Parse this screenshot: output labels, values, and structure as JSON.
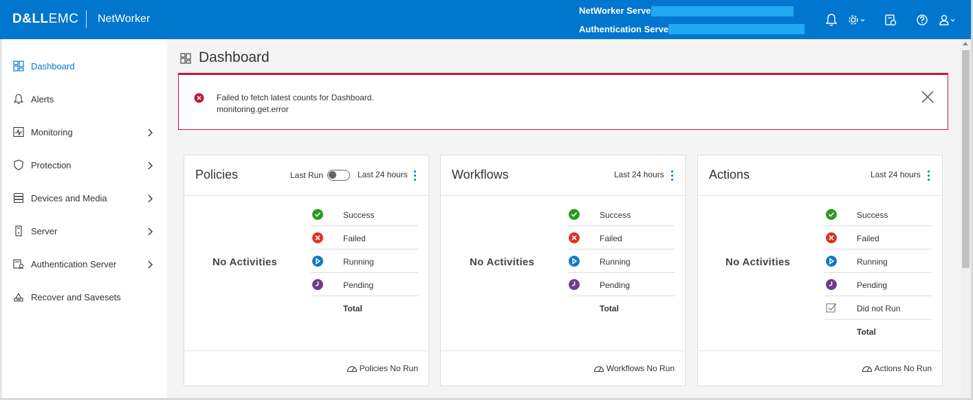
{
  "header": {
    "brand_bold": "D&LL",
    "brand_light": "EMC",
    "product": "NetWorker",
    "networker_server_label": "NetWorker Server:",
    "auth_server_label": "Authentication Server:",
    "icons": [
      "bell-icon",
      "gear-icon",
      "system-settings-icon",
      "help-icon",
      "user-icon"
    ]
  },
  "sidebar": {
    "items": [
      {
        "label": "Dashboard",
        "icon": "dashboard-icon",
        "active": true,
        "has_children": false
      },
      {
        "label": "Alerts",
        "icon": "bell-icon",
        "active": false,
        "has_children": false
      },
      {
        "label": "Monitoring",
        "icon": "monitoring-icon",
        "active": false,
        "has_children": true
      },
      {
        "label": "Protection",
        "icon": "shield-icon",
        "active": false,
        "has_children": true
      },
      {
        "label": "Devices and Media",
        "icon": "storage-icon",
        "active": false,
        "has_children": true
      },
      {
        "label": "Server",
        "icon": "server-icon",
        "active": false,
        "has_children": true
      },
      {
        "label": "Authentication Server",
        "icon": "auth-server-icon",
        "active": false,
        "has_children": true
      },
      {
        "label": "Recover and Savesets",
        "icon": "recover-icon",
        "active": false,
        "has_children": false
      }
    ]
  },
  "main": {
    "title": "Dashboard",
    "alert": {
      "line1": "Failed to fetch latest counts for Dashboard.",
      "line2": "monitoring.get.error"
    },
    "cards": [
      {
        "title": "Policies",
        "toggle_label": "Last Run",
        "range": "Last 24 hours",
        "empty_text": "No Activities",
        "stats": [
          "Success",
          "Failed",
          "Running",
          "Pending",
          "Total"
        ],
        "footer": "Policies No Run"
      },
      {
        "title": "Workflows",
        "range": "Last 24 hours",
        "empty_text": "No Activities",
        "stats": [
          "Success",
          "Failed",
          "Running",
          "Pending",
          "Total"
        ],
        "footer": "Workflows No Run"
      },
      {
        "title": "Actions",
        "range": "Last 24 hours",
        "empty_text": "No Activities",
        "stats": [
          "Success",
          "Failed",
          "Running",
          "Pending",
          "Did not Run",
          "Total"
        ],
        "footer": "Actions No Run"
      }
    ]
  },
  "colors": {
    "brand_blue": "#0076ce",
    "success": "#2b9a1f",
    "failed": "#e0301e",
    "running": "#0d7ac4",
    "pending": "#6b3c8f",
    "error_border": "#c6163c"
  }
}
